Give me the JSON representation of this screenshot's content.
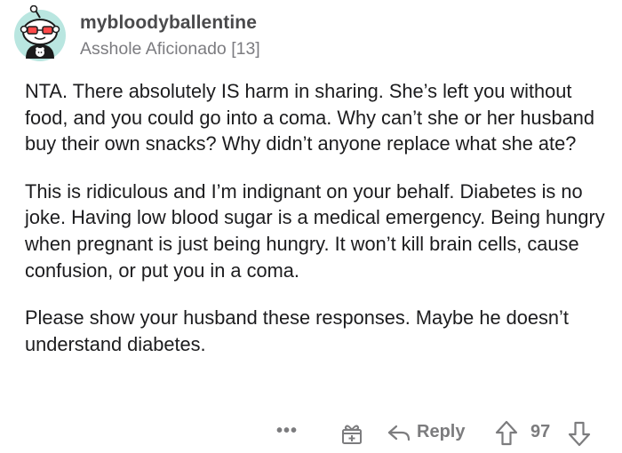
{
  "comment": {
    "author": {
      "username": "mybloodyballentine",
      "flair": "Asshole Aficionado [13]",
      "avatar_icon": "snoo-avatar-icon"
    },
    "paragraphs": [
      "NTA. There absolutely IS harm in sharing. She’s left you without food, and you could go into a coma. Why can’t she or her husband buy their own snacks? Why didn’t anyone replace what she ate?",
      "This is ridiculous and I’m indignant on your behalf. Diabetes is no joke. Having low blood sugar is a medical emergency. Being hungry when pregnant is just being hungry. It won’t kill brain cells, cause confusion, or put you in a coma.",
      "Please show your husband these responses. Maybe he doesn’t understand diabetes."
    ]
  },
  "actions": {
    "more_label": "•••",
    "award_icon": "gift-icon",
    "reply_icon": "reply-arrow-icon",
    "reply_label": "Reply",
    "upvote_icon": "upvote-arrow-icon",
    "score": "97",
    "downvote_icon": "downvote-arrow-icon"
  },
  "colors": {
    "meta_gray": "#7c7c7e",
    "text": "#1c1c1e",
    "avatar_bg": "#b9e6e0"
  }
}
